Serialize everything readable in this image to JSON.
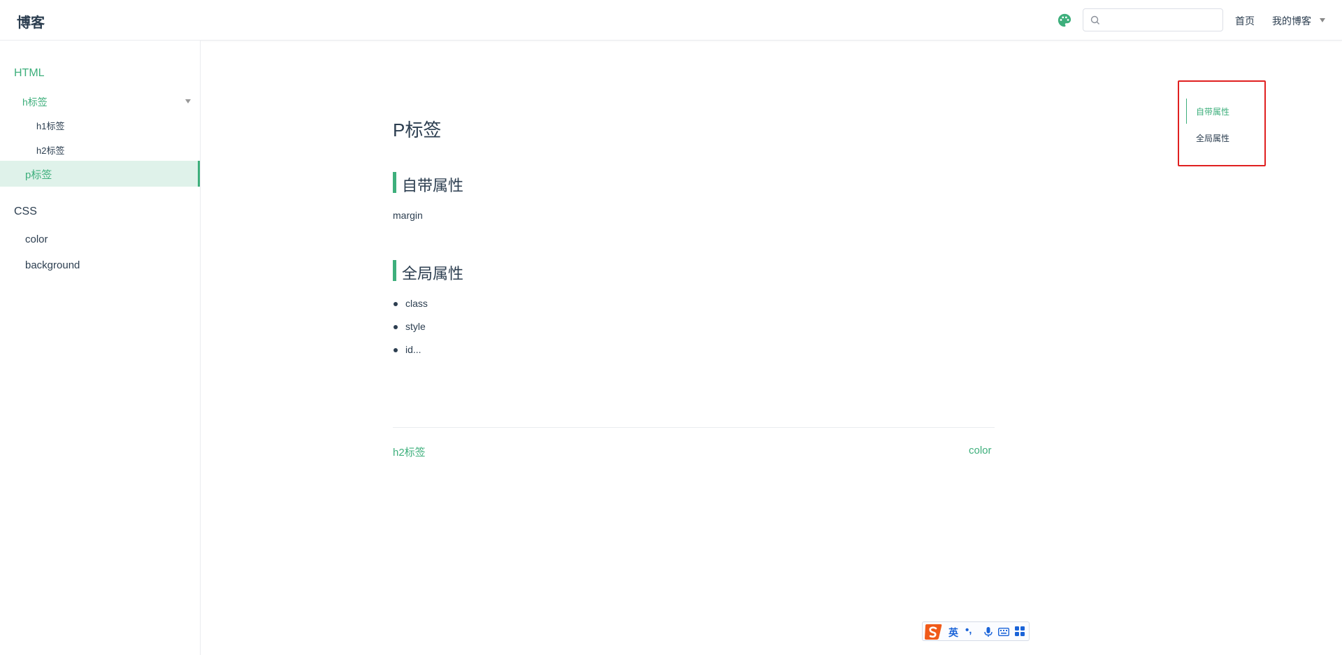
{
  "navbar": {
    "site_name": "博客",
    "search": {
      "value": "",
      "placeholder": ""
    },
    "links": {
      "home": "首页",
      "my_blog": "我的博客"
    },
    "icons": {
      "theme": "palette-icon",
      "search": "search-icon",
      "dropdown": "chevron-down-icon"
    }
  },
  "sidebar": {
    "groups": [
      {
        "title": "HTML",
        "items": [
          {
            "label": "h标签",
            "children": [
              "h1标签",
              "h2标签"
            ]
          },
          {
            "label": "p标签",
            "active": true
          }
        ]
      },
      {
        "title": "CSS",
        "items": [
          {
            "label": "color"
          },
          {
            "label": "background"
          }
        ]
      }
    ]
  },
  "content": {
    "title": "P标签",
    "sections": [
      {
        "heading": "自带属性",
        "text": "margin"
      },
      {
        "heading": "全局属性",
        "bullets": [
          "class",
          "style",
          "id..."
        ]
      }
    ],
    "page_nav": {
      "prev": "h2标签",
      "next": "color"
    }
  },
  "toc": {
    "items": [
      "自带属性",
      "全局属性"
    ],
    "active_index": 0
  },
  "ime_toolbar": {
    "language": "英",
    "punctuation": "•,",
    "icons": [
      "sogou-logo-icon",
      "microphone-icon",
      "keyboard-icon",
      "grid-icon"
    ]
  },
  "colors": {
    "accent": "#3eaf7c",
    "text": "#2c3e50",
    "highlight_border": "#e02020",
    "active_bg": "#dff2ea"
  }
}
